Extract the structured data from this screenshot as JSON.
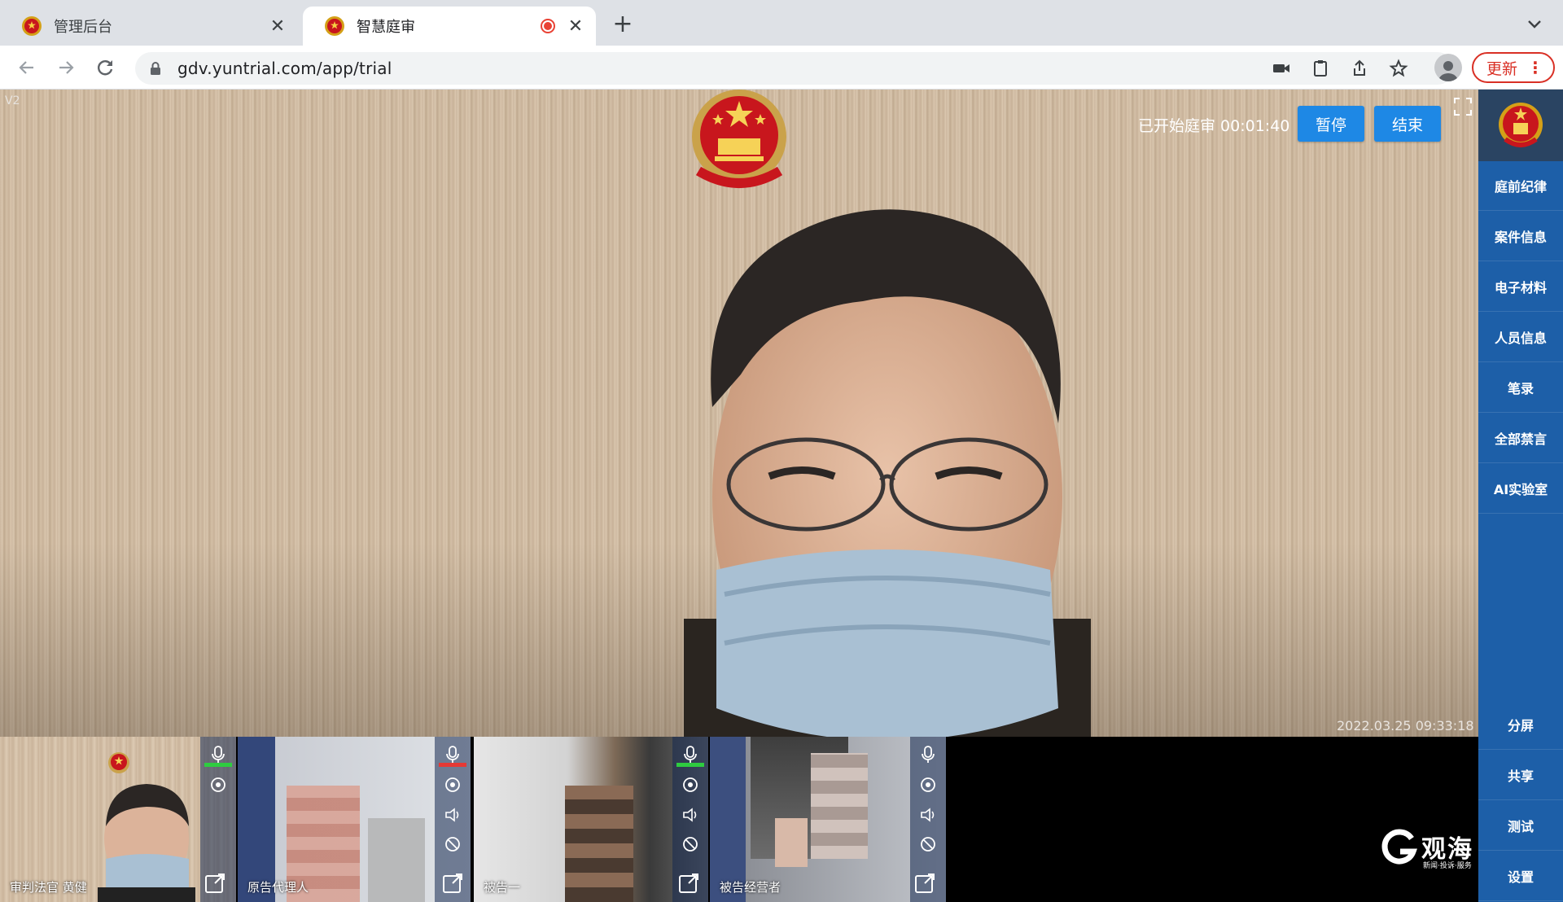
{
  "browser": {
    "tabs": [
      {
        "title": "管理后台",
        "active": false
      },
      {
        "title": "智慧庭审",
        "active": true,
        "recording": true
      }
    ],
    "url": "gdv.yuntrial.com/app/trial",
    "update_label": "更新"
  },
  "trial": {
    "version": "V2",
    "status_text": "已开始庭审 00:01:40",
    "pause_label": "暂停",
    "end_label": "结束",
    "timestamp": "2022.03.25 09:33:18"
  },
  "sidebar": {
    "top_items": [
      "庭前纪律",
      "案件信息",
      "电子材料",
      "人员信息",
      "笔录",
      "全部禁言",
      "AI实验室"
    ],
    "bottom_items": [
      "分屏",
      "共享",
      "测试",
      "设置"
    ]
  },
  "participants": [
    {
      "label": "审判法官 黄健",
      "mic": "on"
    },
    {
      "label": "原告代理人",
      "mic": "muted"
    },
    {
      "label": "被告一",
      "mic": "on"
    },
    {
      "label": "被告经营者",
      "mic": "off"
    }
  ],
  "watermark": {
    "brand": "观海",
    "sub": "新闻·投诉·服务"
  },
  "colors": {
    "accent": "#1e88e5",
    "sidebar": "#1d5fa8",
    "mic_on": "#2ecc40",
    "mic_muted": "#e53935"
  }
}
